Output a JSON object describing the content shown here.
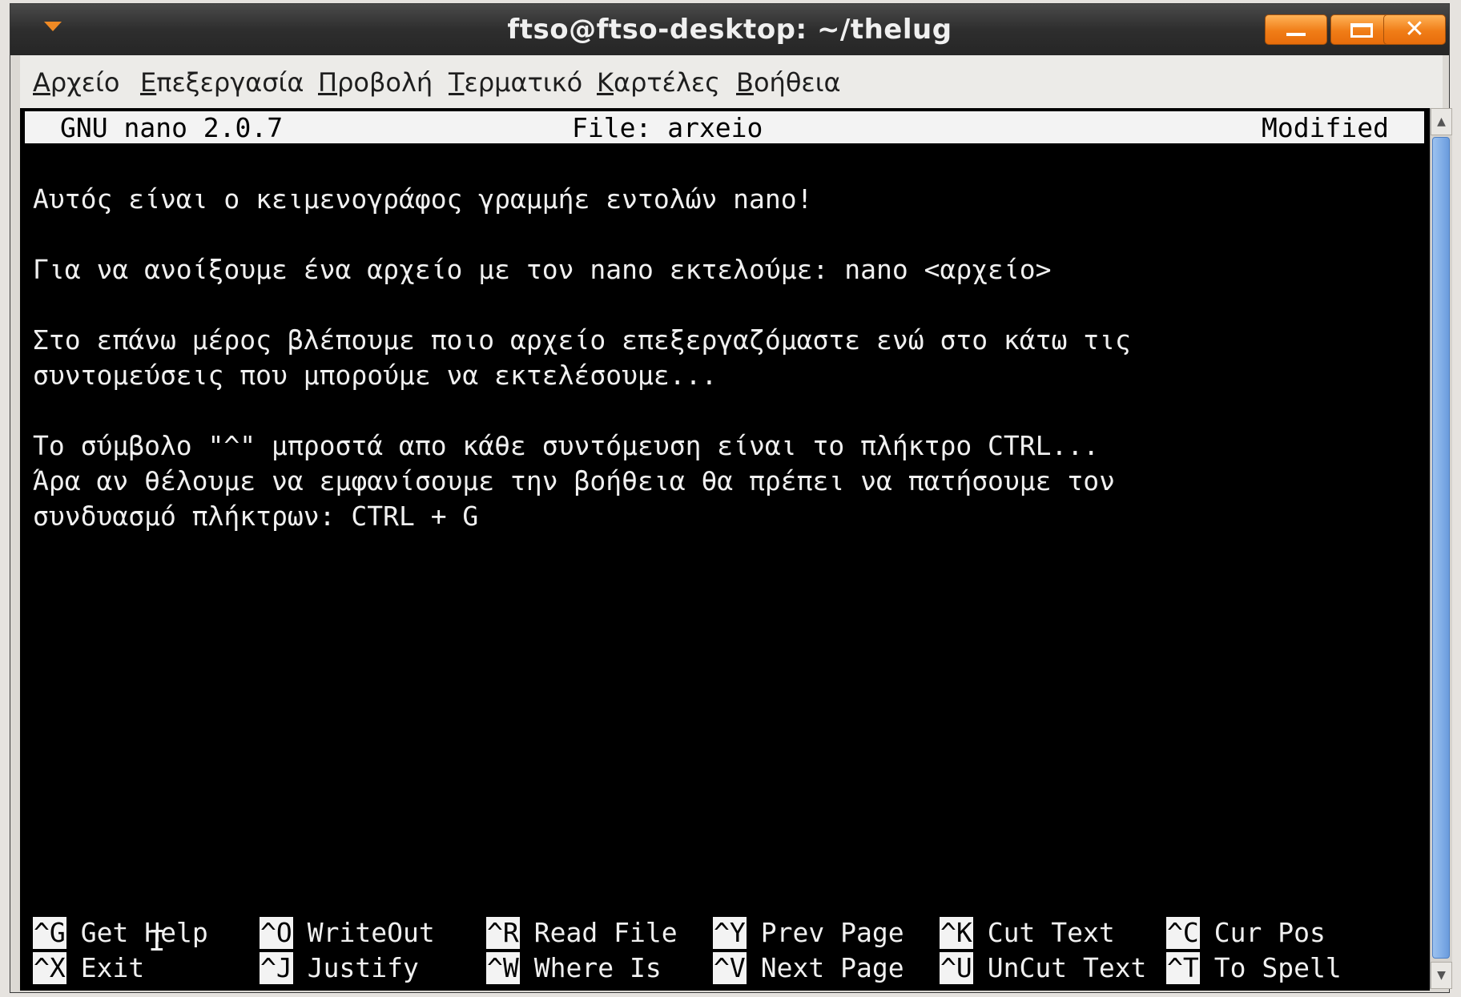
{
  "window": {
    "title": "ftso@ftso-desktop: ~/thelug",
    "close_glyph": "✕"
  },
  "menubar": {
    "items": [
      "Αρχείο",
      "Επεξεργασία",
      "Προβολή",
      "Τερματικό",
      "Καρτέλες",
      "Βοήθεια"
    ]
  },
  "nano": {
    "version": "GNU nano 2.0.7",
    "file": "File: arxeio",
    "status": "Modified",
    "lines": [
      "Αυτός είναι ο κειμενογράφος γραμμήε εντολών nano!",
      "Για να ανοίξουμε ένα αρχείο με τον nano εκτελούμε: nano <αρχείο>",
      "Στο επάνω μέρος βλέπουμε ποιο αρχείο επεξεργαζόμαστε ενώ στο κάτω τις",
      "συντομεύσεις που μπορούμε να εκτελέσουμε...",
      "Το σύμβολο \"^\" μπροστά απο κάθε συντόμευση είναι το πλήκτρο CTRL...",
      "Άρα αν θέλουμε να εμφανίσουμε την βοήθεια θα πρέπει να πατήσουμε τον",
      "συνδυασμό πλήκτρων: CTRL + G"
    ],
    "shortcuts_row1": [
      {
        "key": "^G",
        "label": "Get Help"
      },
      {
        "key": "^O",
        "label": "WriteOut"
      },
      {
        "key": "^R",
        "label": "Read File"
      },
      {
        "key": "^Y",
        "label": "Prev Page"
      },
      {
        "key": "^K",
        "label": "Cut Text"
      },
      {
        "key": "^C",
        "label": "Cur Pos"
      }
    ],
    "shortcuts_row2": [
      {
        "key": "^X",
        "label": "Exit"
      },
      {
        "key": "^J",
        "label": "Justify"
      },
      {
        "key": "^W",
        "label": "Where Is"
      },
      {
        "key": "^V",
        "label": "Next Page"
      },
      {
        "key": "^U",
        "label": "UnCut Text"
      },
      {
        "key": "^T",
        "label": "To Spell"
      }
    ]
  },
  "colors": {
    "terminal_bg": "#000000",
    "terminal_fg": "#f0f0f0",
    "titlebar_button": "#f07d17",
    "scrollbar_thumb": "#7eabe6"
  },
  "icons": {
    "window_menu": "chevron-down-icon",
    "minimize": "minimize-icon",
    "maximize": "maximize-icon",
    "close": "close-icon",
    "cursor": "text-cursor-icon"
  }
}
